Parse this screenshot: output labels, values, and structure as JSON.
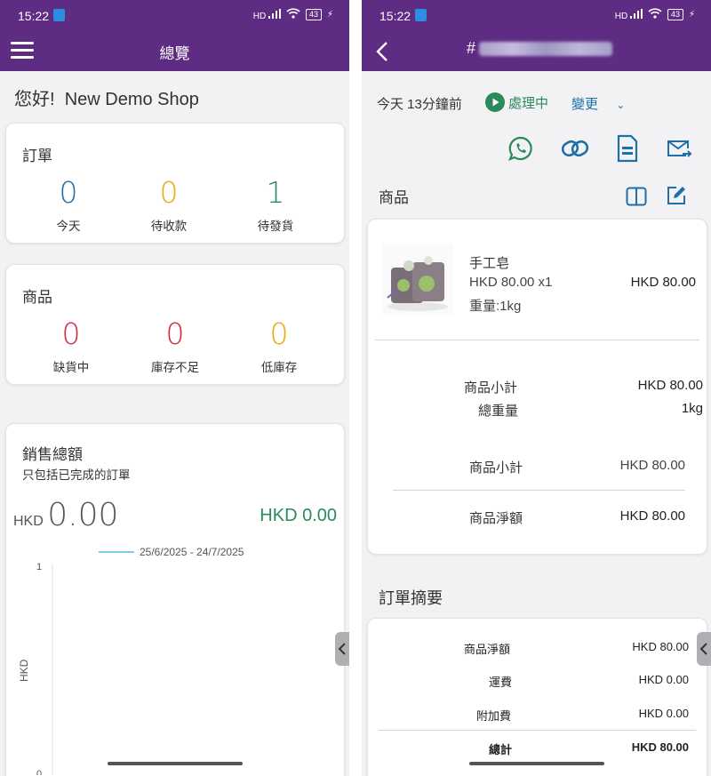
{
  "status": {
    "time": "15:22",
    "battery": "43",
    "signal": "HD"
  },
  "left": {
    "app_title": "總覽",
    "greeting": "您好!",
    "shop_name": "New Demo Shop",
    "orders_card": {
      "title": "訂單",
      "stats": [
        {
          "value": "0",
          "label": "今天",
          "color": "#1f6fa8"
        },
        {
          "value": "0",
          "label": "待收款",
          "color": "#e7ab16"
        },
        {
          "value": "1",
          "label": "待發貨",
          "color": "#2a8a5c"
        }
      ]
    },
    "products_card": {
      "title": "商品",
      "stats": [
        {
          "value": "0",
          "label": "缺貨中",
          "color": "#cf2f3c"
        },
        {
          "value": "0",
          "label": "庫存不足",
          "color": "#cf2f3c"
        },
        {
          "value": "0",
          "label": "低庫存",
          "color": "#e7ab16"
        }
      ]
    },
    "sales_card": {
      "title": "銷售總額",
      "subtitle": "只包括已完成的訂單",
      "currency": "HKD",
      "total": "0.00",
      "compare": "HKD 0.00",
      "compare_color": "#2a8a5c"
    },
    "chart_data": {
      "type": "line",
      "series": [
        {
          "name": "25/6/2025 - 24/7/2025",
          "values": []
        }
      ],
      "ylabel": "HKD",
      "y_ticks": [
        "1",
        "0"
      ],
      "ylim": [
        0,
        1
      ],
      "legend_color": "#7ecbe9",
      "legend_position": "top"
    }
  },
  "right": {
    "order_prefix": "#",
    "time_text": "今天 13分鐘前",
    "status_label": "處理中",
    "change_label": "變更",
    "section_products": "商品",
    "item": {
      "name": "手工皂",
      "price_qty": "HKD 80.00 x1",
      "weight": "重量:1kg",
      "total": "HKD 80.00"
    },
    "product_summary": {
      "subtotal_label": "商品小計",
      "subtotal_value": "HKD 80.00",
      "weight_label": "總重量",
      "weight_value": "1kg",
      "subtotal2_label": "商品小計",
      "subtotal2_value": "HKD 80.00",
      "net_label": "商品淨額",
      "net_value": "HKD 80.00"
    },
    "section_order_summary": "訂單摘要",
    "order_summary": {
      "net_label": "商品淨額",
      "net_value": "HKD 80.00",
      "shipping_label": "運費",
      "shipping_value": "HKD 0.00",
      "extra_label": "附加費",
      "extra_value": "HKD 0.00",
      "total_label": "總計",
      "total_value": "HKD 80.00"
    },
    "accent": "#1f6fa8",
    "status_color": "#2a8a5c"
  }
}
